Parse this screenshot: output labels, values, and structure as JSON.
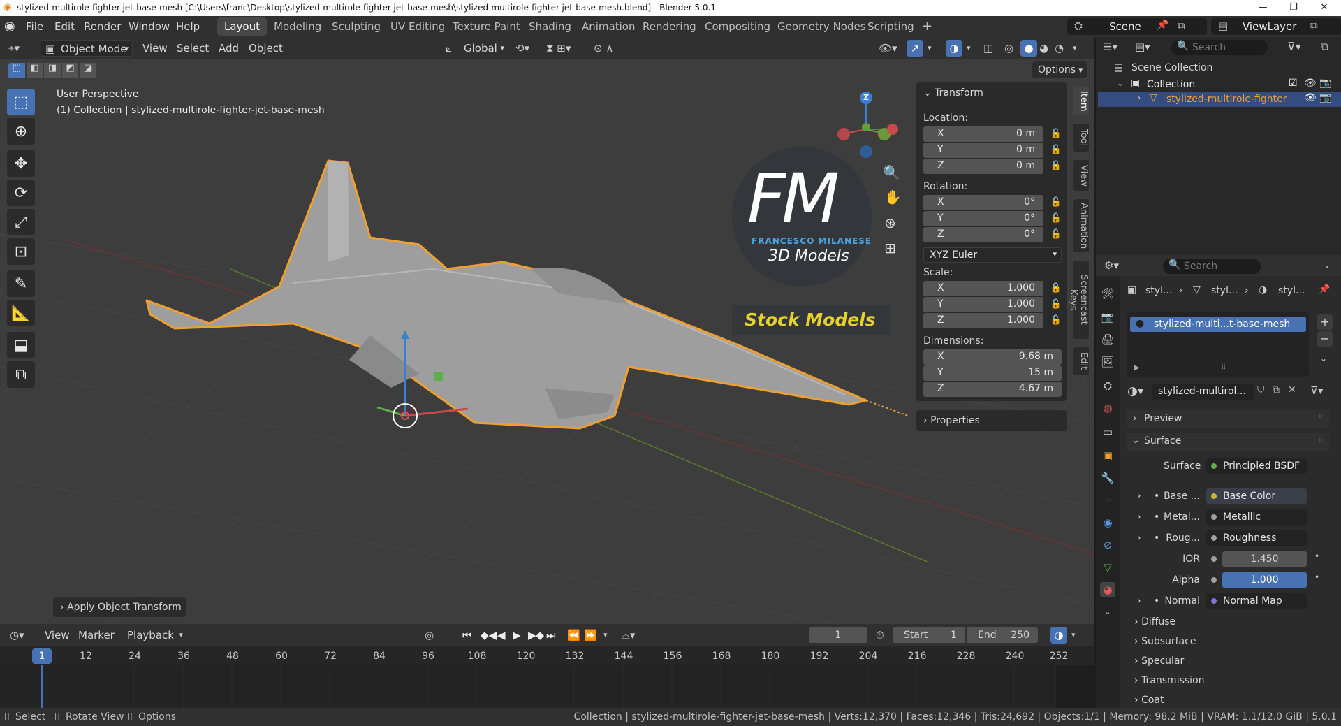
{
  "titlebar": {
    "title": "stylized-multirole-fighter-jet-base-mesh [C:\\Users\\franc\\Desktop\\stylized-multirole-fighter-jet-base-mesh\\stylized-multirole-fighter-jet-base-mesh.blend] - Blender 5.0.1",
    "minimize": "—",
    "maximize": "❐",
    "close": "✕"
  },
  "menu": [
    "File",
    "Edit",
    "Render",
    "Window",
    "Help"
  ],
  "workspaces": [
    "Layout",
    "Modeling",
    "Sculpting",
    "UV Editing",
    "Texture Paint",
    "Shading",
    "Animation",
    "Rendering",
    "Compositing",
    "Geometry Nodes",
    "Scripting"
  ],
  "workspace_add": "+",
  "scene": "Scene",
  "view_layer": "ViewLayer",
  "header3d": {
    "mode": "Object Mode",
    "menus": [
      "View",
      "Select",
      "Add",
      "Object"
    ],
    "orientation": "Global",
    "options": "Options"
  },
  "viewport": {
    "perspective": "User Perspective",
    "collection_info": "(1) Collection | stylized-multirole-fighter-jet-base-mesh",
    "gizmo_axes": {
      "z": "Z"
    },
    "watermark": {
      "logo": "FM",
      "name": "FRANCESCO MILANESE",
      "subtitle": "3D Models",
      "stock": "Stock Models"
    },
    "operator_panel": "Apply Object Transform"
  },
  "npanel": {
    "section": "Transform",
    "location_label": "Location:",
    "location": [
      {
        "axis": "X",
        "value": "0 m"
      },
      {
        "axis": "Y",
        "value": "0 m"
      },
      {
        "axis": "Z",
        "value": "0 m"
      }
    ],
    "rotation_label": "Rotation:",
    "rotation": [
      {
        "axis": "X",
        "value": "0°"
      },
      {
        "axis": "Y",
        "value": "0°"
      },
      {
        "axis": "Z",
        "value": "0°"
      }
    ],
    "rotation_mode": "XYZ Euler",
    "scale_label": "Scale:",
    "scale": [
      {
        "axis": "X",
        "value": "1.000"
      },
      {
        "axis": "Y",
        "value": "1.000"
      },
      {
        "axis": "Z",
        "value": "1.000"
      }
    ],
    "dimensions_label": "Dimensions:",
    "dimensions": [
      {
        "axis": "X",
        "value": "9.68 m"
      },
      {
        "axis": "Y",
        "value": "15 m"
      },
      {
        "axis": "Z",
        "value": "4.67 m"
      }
    ],
    "properties": "Properties",
    "tabs": [
      "Item",
      "Tool",
      "View",
      "Animation",
      "Screencast Keys",
      "Edit"
    ]
  },
  "outliner": {
    "search_placeholder": "Search",
    "scene_collection": "Scene Collection",
    "collection": "Collection",
    "object": "stylized-multirole-fighter"
  },
  "properties": {
    "search_placeholder": "Search",
    "breadcrumb": [
      "styl...",
      "styl...",
      "styl..."
    ],
    "material_slot": "stylized-multi...t-base-mesh",
    "material_name": "stylized-multirol...",
    "preview": "Preview",
    "surface_section": "Surface",
    "surface_label": "Surface",
    "surface_value": "Principled BSDF",
    "inputs": [
      {
        "label": "Base ...",
        "value": "Base Color",
        "color": "#c8b432"
      },
      {
        "label": "Metal...",
        "value": "Metallic",
        "color": "#a0a0a0"
      },
      {
        "label": "Roug...",
        "value": "Roughness",
        "color": "#a0a0a0"
      }
    ],
    "ior_label": "IOR",
    "ior_value": "1.450",
    "alpha_label": "Alpha",
    "alpha_value": "1.000",
    "normal_label": "Normal",
    "normal_value": "Normal Map",
    "sections": [
      "Diffuse",
      "Subsurface",
      "Specular",
      "Transmission",
      "Coat"
    ]
  },
  "timeline": {
    "menus": [
      "View",
      "Marker",
      "Playback"
    ],
    "current_frame": "1",
    "start_label": "Start",
    "start": "1",
    "end_label": "End",
    "end": "250",
    "frame_marks": [
      "1",
      "12",
      "24",
      "36",
      "48",
      "60",
      "72",
      "84",
      "96",
      "108",
      "120",
      "132",
      "144",
      "156",
      "168",
      "180",
      "192",
      "204",
      "216",
      "228",
      "240",
      "252"
    ]
  },
  "status": {
    "hints": [
      "Select",
      "Rotate View",
      "Options"
    ],
    "stats": "Collection | stylized-multirole-fighter-jet-base-mesh | Verts:12,370 | Faces:12,346 | Tris:24,692 | Objects:1/1 | Memory: 98.2 MiB | VRAM: 1.1/12.0 GiB | 5.0.1"
  },
  "colors": {
    "accent": "#4772b3",
    "selection_outline": "#f0a030",
    "stock_text": "#e6d22a",
    "logo_blue": "#4aa3e0"
  }
}
